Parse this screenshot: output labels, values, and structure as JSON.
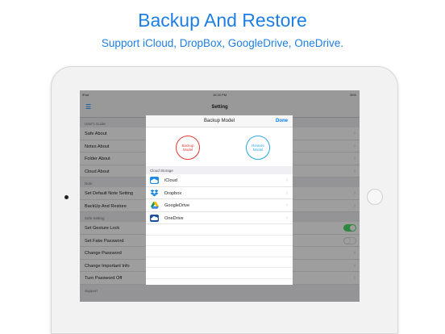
{
  "promo": {
    "title": "Backup And Restore",
    "subtitle": "Support iCloud, DropBox, GoogleDrive, OneDrive."
  },
  "status_bar": {
    "carrier": "iPad",
    "time": "10:20 PM",
    "battery": "35%"
  },
  "nav": {
    "title": "Setting",
    "menu_icon": "hamburger-icon"
  },
  "settings": {
    "sections": [
      {
        "header": "User's Guide",
        "rows": [
          "Safe About",
          "Notes About",
          "Folder About",
          "Cloud About"
        ]
      },
      {
        "header": "Note",
        "rows": [
          "Set Default Note Setting",
          "BackUp And Restore"
        ]
      },
      {
        "header": "Safe Setting",
        "rows": [
          "Set Gesture Lock",
          "Set Fake Password",
          "Change Password",
          "Change Important Info",
          "Turn Password Off"
        ]
      },
      {
        "header": "Support",
        "rows": []
      }
    ],
    "toggles": {
      "gesture_lock": true,
      "fake_password": false
    }
  },
  "modal": {
    "title": "Backup Model",
    "done": "Done",
    "backup_circle": [
      "Backup",
      "Model"
    ],
    "restore_circle": [
      "Restore",
      "Model"
    ],
    "cloud_header": "Cloud Storage",
    "providers": [
      {
        "label": "iCloud",
        "icon": "icloud-icon"
      },
      {
        "label": "Dropbox",
        "icon": "dropbox-icon"
      },
      {
        "label": "GoogleDrive",
        "icon": "google-drive-icon"
      },
      {
        "label": "OneDrive",
        "icon": "onedrive-icon"
      }
    ]
  },
  "colors": {
    "brand_blue": "#1d7fe6",
    "ios_blue": "#007aff",
    "backup_red": "#e53935",
    "restore_blue": "#29a8e8",
    "toggle_green": "#4cd964"
  }
}
